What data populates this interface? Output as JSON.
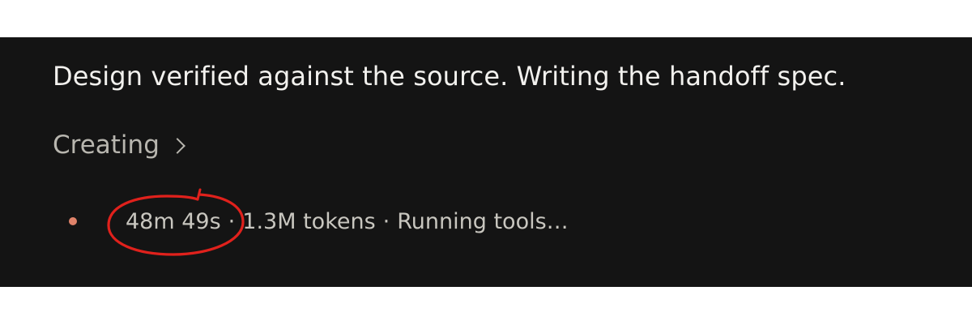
{
  "message": {
    "text": "Design verified against the source. Writing the handoff spec."
  },
  "status": {
    "label": "Creating",
    "elapsed": "48m 49s",
    "separator": "·",
    "tokens": "1.3M tokens",
    "activity": "Running tools…"
  },
  "colors": {
    "panel_bg": "#141414",
    "indicator_dot": "#e0836a",
    "annotation": "#e0211c"
  },
  "icons": {
    "expand": "chevron-right-icon",
    "indicator": "status-dot-icon"
  },
  "annotation": {
    "shape": "hand-drawn-ellipse",
    "target": "elapsed time"
  }
}
